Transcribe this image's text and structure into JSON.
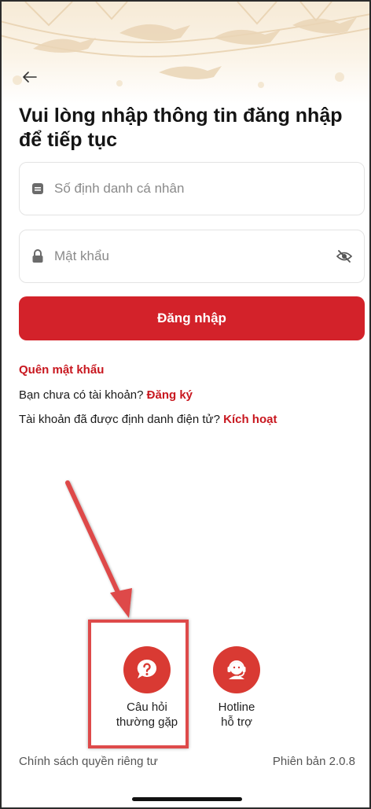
{
  "header": {
    "back_icon": "arrow-left-icon",
    "title": "Vui lòng nhập thông tin đăng nhập để tiếp tục"
  },
  "form": {
    "id_field": {
      "placeholder": "Số định danh cá nhân",
      "icon": "id-card-icon",
      "value": ""
    },
    "password_field": {
      "placeholder": "Mật khẩu",
      "icon": "lock-icon",
      "toggle_icon": "eye-off-icon",
      "value": ""
    },
    "login_button": "Đăng nhập"
  },
  "links": {
    "forgot_password": "Quên mật khẩu",
    "no_account_text": "Bạn chưa có tài khoản?",
    "register": "Đăng ký",
    "identified_text": "Tài khoản đã được định danh điện tử?",
    "activate": "Kích hoạt"
  },
  "quick_actions": [
    {
      "label_line1": "Câu hỏi",
      "label_line2": "thường gặp",
      "icon": "question-chat-icon"
    },
    {
      "label_line1": "Hotline",
      "label_line2": "hỗ trợ",
      "icon": "headset-support-icon"
    }
  ],
  "footer": {
    "privacy": "Chính sách quyền riêng tư",
    "version": "Phiên bản 2.0.8"
  },
  "colors": {
    "accent": "#d3222a",
    "link": "#c8171f",
    "annotation": "#de4a4a"
  }
}
